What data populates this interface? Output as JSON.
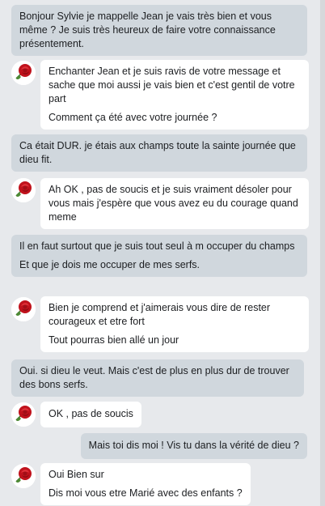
{
  "messages": [
    {
      "from": "sent",
      "lines": [
        "Bonjour Sylvie je mappelle Jean je vais très bien et vous même ? Je suis très heureux de faire votre connaissance présentement."
      ]
    },
    {
      "from": "recv",
      "lines": [
        "Enchanter Jean et je suis ravis de votre message et sache que moi aussi je vais bien et c'est gentil de votre part",
        "Comment ça été avec votre journée ?"
      ]
    },
    {
      "from": "sent",
      "lines": [
        "Ca était DUR. je étais aux champs toute la sainte journée que dieu fit."
      ]
    },
    {
      "from": "recv",
      "lines": [
        "Ah OK , pas de soucis et je suis vraiment désoler pour vous mais j'espère que vous avez eu du courage quand meme"
      ]
    },
    {
      "from": "sent",
      "lines": [
        "Il en faut surtout que je suis tout seul à m occuper du champs",
        "Et que je dois me occuper de mes serfs."
      ]
    },
    {
      "from": "recv",
      "lines": [
        "Bien je comprend et j'aimerais vous dire de rester courageux et etre fort",
        "Tout pourras bien allé un jour"
      ]
    },
    {
      "from": "sent",
      "lines": [
        "Oui. si dieu le veut. Mais c'est de plus en plus dur de trouver des bons serfs."
      ]
    },
    {
      "from": "recv",
      "lines": [
        "OK , pas de soucis"
      ]
    },
    {
      "from": "sent",
      "lines": [
        "Mais toi dis moi ! Vis tu dans la vérité de dieu ?"
      ]
    },
    {
      "from": "recv",
      "lines": [
        "Oui Bien sur",
        "Dis moi vous etre Marié avec des enfants ?"
      ]
    }
  ],
  "colors": {
    "sent_bubble": "#d0d7dd",
    "recv_bubble": "#ffffff",
    "background": "#e7e9ec"
  },
  "icons": {
    "avatar": "rose-avatar-icon"
  }
}
